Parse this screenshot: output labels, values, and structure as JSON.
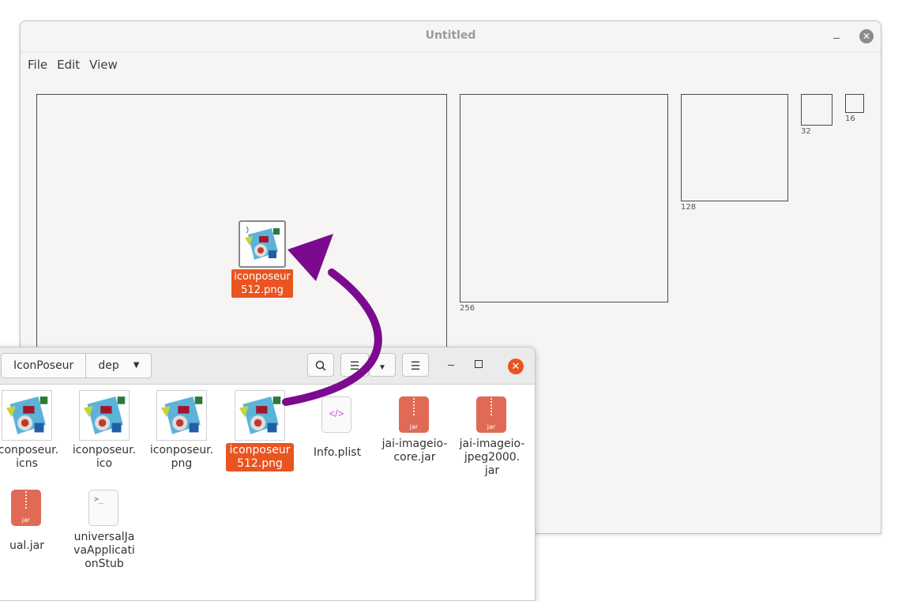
{
  "app": {
    "title": "Untitled",
    "menu": [
      "File",
      "Edit",
      "View"
    ],
    "slots": [
      {
        "label": ""
      },
      {
        "label": "256"
      },
      {
        "label": "128"
      },
      {
        "label": "32"
      },
      {
        "label": "16"
      }
    ],
    "dropped": {
      "label": "iconposeur\n512.png",
      "icon": "image-icon"
    }
  },
  "file_manager": {
    "path": [
      "IconPoseur",
      "dep"
    ],
    "files": [
      {
        "label": "iconposeur.\nicns",
        "icon": "image-icon"
      },
      {
        "label": "iconposeur.\nico",
        "icon": "image-icon"
      },
      {
        "label": "iconposeur.\npng",
        "icon": "image-icon"
      },
      {
        "label": "iconposeur\n512.png",
        "icon": "image-icon",
        "selected": true
      },
      {
        "label": "Info.plist",
        "icon": "xml-file-icon"
      },
      {
        "label": "jai-imageio-\ncore.jar",
        "icon": "jar-file-icon"
      },
      {
        "label": "jai-imageio-\njpeg2000.\njar",
        "icon": "jar-file-icon"
      },
      {
        "label": "ual.jar",
        "icon": "jar-file-icon"
      },
      {
        "label": "universalJa\nvaApplicati\nonStub",
        "icon": "script-file-icon"
      }
    ],
    "jar_badge": "jar",
    "xml_glyph": "</>",
    "script_glyph": ">_"
  },
  "colors": {
    "accent": "#e95420",
    "arrow": "#7b0a8f",
    "jar": "#e06a55"
  }
}
